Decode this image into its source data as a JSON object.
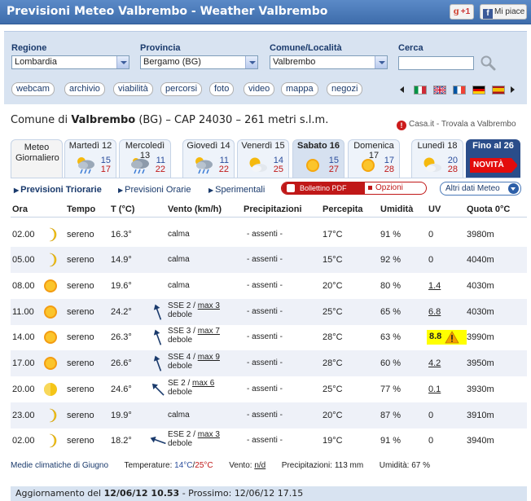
{
  "header": {
    "title": "Previsioni Meteo Valbrembo - Weather Valbrembo",
    "gplus_label": "+1",
    "fb_label": "Mi piace"
  },
  "search": {
    "regione_label": "Regione",
    "regione_value": "Lombardia",
    "provincia_label": "Provincia",
    "provincia_value": "Bergamo (BG)",
    "comune_label": "Comune/Località",
    "comune_value": "Valbrembo",
    "cerca_label": "Cerca",
    "cerca_value": ""
  },
  "nav": {
    "buttons": [
      "webcam",
      "archivio",
      "viabilità",
      "percorsi",
      "foto",
      "video",
      "mappa",
      "negozi"
    ],
    "flags": [
      "italian-flag",
      "uk-flag",
      "french-flag",
      "german-flag",
      "spanish-flag"
    ]
  },
  "location": {
    "prefix": "Comune di",
    "name": "Valbrembo",
    "rest": "(BG) – CAP 24030 – 261 metri s.l.m.",
    "casa_link": "Casa.it - Trovala a Valbrembo"
  },
  "days": [
    {
      "name": "Meteo Giornaliero",
      "max": "",
      "min": "",
      "icon": ""
    },
    {
      "name": "Martedì 12",
      "max": "15",
      "min": "17",
      "icon": "cloud-rain"
    },
    {
      "name": "Mercoledì 13",
      "max": "11",
      "min": "22",
      "icon": "cloud-rain"
    },
    {
      "name": "Giovedì 14",
      "max": "11",
      "min": "22",
      "icon": "cloud-rain"
    },
    {
      "name": "Venerdì 15",
      "max": "14",
      "min": "25",
      "icon": "sun-cloud"
    },
    {
      "name": "Sabato 16",
      "max": "15",
      "min": "27",
      "icon": "sun"
    },
    {
      "name": "Domenica 17",
      "max": "17",
      "min": "28",
      "icon": "sun"
    },
    {
      "name": "Lunedì 18",
      "max": "20",
      "min": "28",
      "icon": "sun-cloud"
    },
    {
      "name": "Fino al 26",
      "badge": "NOVITÀ"
    }
  ],
  "subnav": {
    "triorarie": "Previsioni Triorarie",
    "orarie": "Previsioni Orarie",
    "sperimentali": "Sperimentali",
    "pdf": "Bollettino PDF",
    "opzioni": "Opzioni",
    "altri": "Altri dati Meteo"
  },
  "table": {
    "headers": [
      "Ora",
      "Tempo",
      "T (°C)",
      "Vento (km/h)",
      "Precipitazioni",
      "Percepita",
      "Umidità",
      "UV",
      "Quota 0°C"
    ],
    "rows": [
      {
        "ora": "02.00",
        "icon": "moon",
        "tempo": "sereno",
        "t": "16.3°",
        "wind_dir": "",
        "wind_line1": "calma",
        "wind_line2": "",
        "precip": "- assenti -",
        "perc": "17°C",
        "umid": "91 %",
        "uv": "0",
        "quota": "3980m"
      },
      {
        "ora": "05.00",
        "icon": "moon",
        "tempo": "sereno",
        "t": "14.9°",
        "wind_dir": "",
        "wind_line1": "calma",
        "wind_line2": "",
        "precip": "- assenti -",
        "perc": "15°C",
        "umid": "92 %",
        "uv": "0",
        "quota": "4040m"
      },
      {
        "ora": "08.00",
        "icon": "sun",
        "tempo": "sereno",
        "t": "19.6°",
        "wind_dir": "",
        "wind_line1": "calma",
        "wind_line2": "",
        "precip": "- assenti -",
        "perc": "20°C",
        "umid": "80 %",
        "uv": "1.4",
        "quota": "4030m"
      },
      {
        "ora": "11.00",
        "icon": "sun",
        "tempo": "sereno",
        "t": "24.2°",
        "wind_dir": "SSE 2",
        "wind_max": "max 3",
        "wind_line2": "debole",
        "precip": "- assenti -",
        "perc": "25°C",
        "umid": "65 %",
        "uv": "6.8",
        "quota": "4030m"
      },
      {
        "ora": "14.00",
        "icon": "sun",
        "tempo": "sereno",
        "t": "26.3°",
        "wind_dir": "SSE 3",
        "wind_max": "max 7",
        "wind_line2": "debole",
        "precip": "- assenti -",
        "perc": "28°C",
        "umid": "63 %",
        "uv": "8.8",
        "quota": "3990m"
      },
      {
        "ora": "17.00",
        "icon": "sun",
        "tempo": "sereno",
        "t": "26.6°",
        "wind_dir": "SSE 4",
        "wind_max": "max 9",
        "wind_line2": "debole",
        "precip": "- assenti -",
        "perc": "28°C",
        "umid": "60 %",
        "uv": "4.2",
        "quota": "3950m"
      },
      {
        "ora": "20.00",
        "icon": "sun-low",
        "tempo": "sereno",
        "t": "24.6°",
        "wind_dir": "SE 2",
        "wind_max": "max 6",
        "wind_line2": "debole",
        "precip": "- assenti -",
        "perc": "25°C",
        "umid": "77 %",
        "uv": "0.1",
        "quota": "3930m"
      },
      {
        "ora": "23.00",
        "icon": "moon",
        "tempo": "sereno",
        "t": "19.9°",
        "wind_dir": "",
        "wind_line1": "calma",
        "wind_line2": "",
        "precip": "- assenti -",
        "perc": "20°C",
        "umid": "87 %",
        "uv": "0",
        "quota": "3910m"
      },
      {
        "ora": "02.00",
        "icon": "moon",
        "tempo": "sereno",
        "t": "18.2°",
        "wind_dir": "ESE 2",
        "wind_max": "max 3",
        "wind_line2": "debole",
        "precip": "- assenti -",
        "perc": "19°C",
        "umid": "91 %",
        "uv": "0",
        "quota": "3940m"
      }
    ]
  },
  "footer": {
    "medie": "Medie climatiche di Giugno",
    "temp_label": "Temperature:",
    "temp_min": "14°C",
    "temp_sep": "/",
    "temp_max": "25°C",
    "vento_label": "Vento:",
    "vento_value": "n/d",
    "precip": "Precipitazioni: 113 mm",
    "umid": "Umidità: 67 %",
    "update_label": "Aggiornamento del",
    "update_value": "12/06/12 10.53",
    "next_label": "- Prossimo:",
    "next_value": "12/06/12 17.15"
  },
  "colors": {
    "header_blue": "#4a79b8",
    "panel_blue": "#d8e3f1",
    "max_temp": "#2a4d9c",
    "min_temp": "#c01818",
    "uv_high": "#ffff00"
  }
}
